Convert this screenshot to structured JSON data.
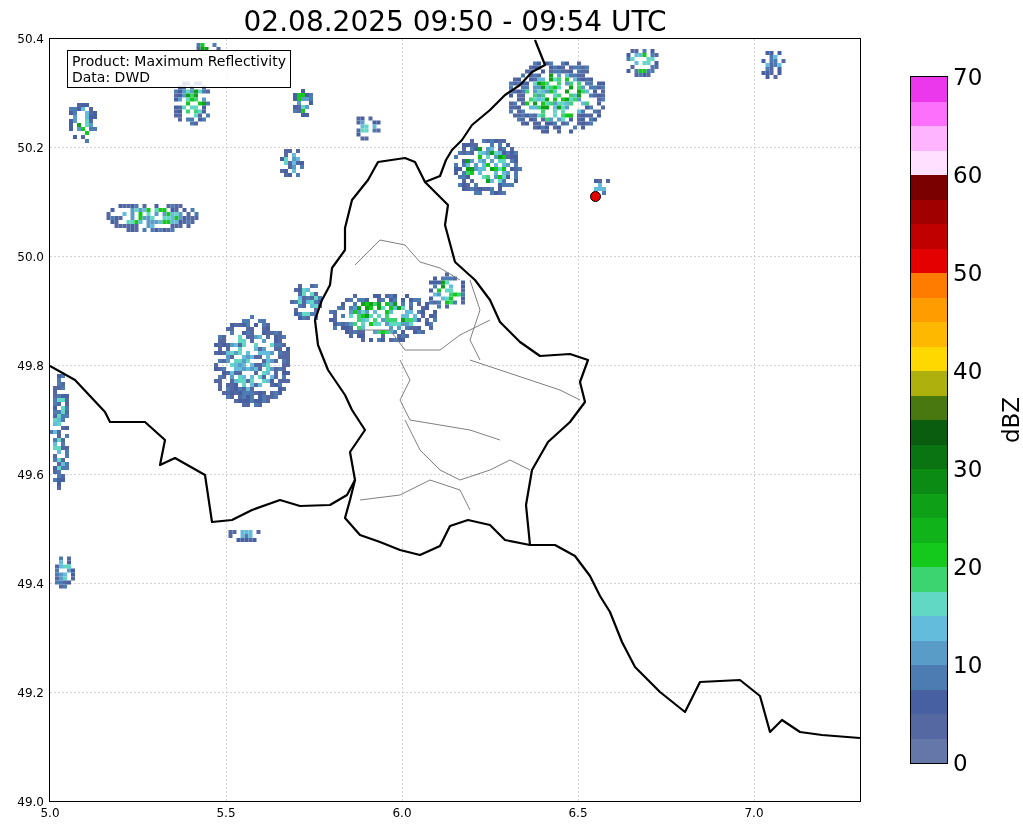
{
  "title": "02.08.2025 09:50 - 09:54 UTC",
  "legend": [
    "Product: Maximum Reflectivity",
    "Data: DWD"
  ],
  "x_ticks": [
    "5.0",
    "5.5",
    "6.0",
    "6.5",
    "7.0"
  ],
  "y_ticks": [
    "50.4",
    "50.2",
    "50.0",
    "49.8",
    "49.6",
    "49.4",
    "49.2",
    "49.0"
  ],
  "colorbar": {
    "label": "dBZ",
    "ticks": [
      "70",
      "60",
      "50",
      "40",
      "30",
      "20",
      "10",
      "0"
    ],
    "segments": [
      {
        "color": "#ec38ec"
      },
      {
        "color": "#fc70fc"
      },
      {
        "color": "#ffb4ff"
      },
      {
        "color": "#ffe0ff"
      },
      {
        "color": "#7a0000"
      },
      {
        "color": "#a00000"
      },
      {
        "color": "#c00000"
      },
      {
        "color": "#e40000"
      },
      {
        "color": "#ff7c00"
      },
      {
        "color": "#ff9c00"
      },
      {
        "color": "#ffb800"
      },
      {
        "color": "#ffd800"
      },
      {
        "color": "#aeb00e"
      },
      {
        "color": "#4a7810"
      },
      {
        "color": "#0a5c0e"
      },
      {
        "color": "#0a7412"
      },
      {
        "color": "#0b8a14"
      },
      {
        "color": "#0ea016"
      },
      {
        "color": "#10b41a"
      },
      {
        "color": "#14c81c"
      },
      {
        "color": "#3cd470"
      },
      {
        "color": "#60d8c4"
      },
      {
        "color": "#64bcdc"
      },
      {
        "color": "#5a9cc8"
      },
      {
        "color": "#4c7cb2"
      },
      {
        "color": "#4660a2"
      },
      {
        "color": "#5568a2"
      },
      {
        "color": "#6576a8"
      }
    ]
  }
}
